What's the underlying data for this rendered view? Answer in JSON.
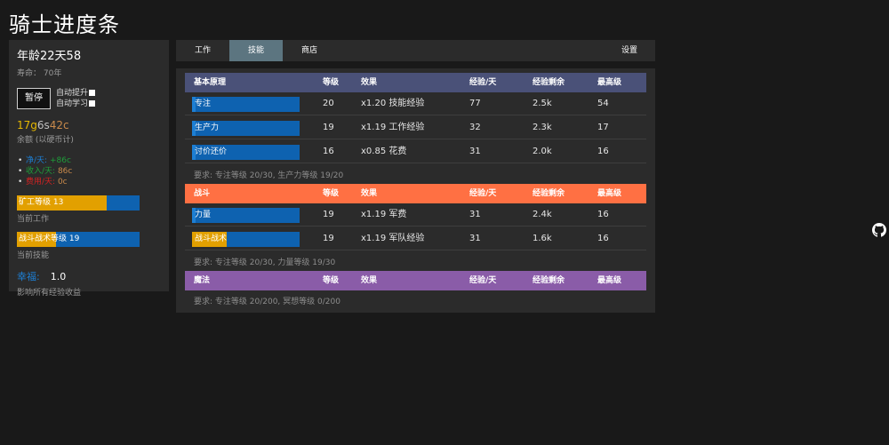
{
  "app": {
    "title": "骑士进度条"
  },
  "sidebar": {
    "age": "年龄22天58",
    "lifespan": "寿命： 70年",
    "pause_label": "暂停",
    "auto_promote_label": "自动提升",
    "auto_learn_label": "自动学习",
    "money": {
      "gold": "17g",
      "silver": "6s",
      "copper": "42c"
    },
    "balance_label": "余额 (以硬币计)",
    "stats": [
      {
        "label": "净/天:",
        "value": "+86c",
        "label_color": "#1d7fd4",
        "value_color": "#1f9e3a"
      },
      {
        "label": "收入/天:",
        "value": "86c",
        "label_color": "#1f9e3a",
        "value_color": "#c98a4b"
      },
      {
        "label": "费用/天:",
        "value": "0c",
        "label_color": "#d42222",
        "value_color": "#c98a4b"
      }
    ],
    "current_job": {
      "label": "矿工等级 13",
      "sub": "当前工作",
      "progress": 0.73
    },
    "current_skill": {
      "label": "战斗战术等级 19",
      "sub": "当前技能",
      "progress": 0.32
    },
    "happiness": {
      "label": "幸福:",
      "value": "1.0",
      "sub": "影响所有经验收益"
    }
  },
  "tabs": [
    {
      "label": "工作",
      "active": false
    },
    {
      "label": "技能",
      "active": true
    },
    {
      "label": "商店",
      "active": false
    },
    {
      "label": "设置",
      "active": false
    }
  ],
  "columns": {
    "level": "等级",
    "effect": "效果",
    "xp_day": "经验/天",
    "xp_left": "经验剩余",
    "max_level": "最高级"
  },
  "categories": [
    {
      "name": "基本原理",
      "color": "#4a5178",
      "rows": [
        {
          "name": "专注",
          "level": "20",
          "effect": "x1.20 技能经验",
          "xp_day": "77",
          "xp_left": "2.5k",
          "max": "54",
          "progress": 0.03,
          "fill": "#1d7fd4"
        },
        {
          "name": "生产力",
          "level": "19",
          "effect": "x1.19 工作经验",
          "xp_day": "32",
          "xp_left": "2.3k",
          "max": "17",
          "progress": 0.03,
          "fill": "#1d7fd4"
        },
        {
          "name": "讨价还价",
          "level": "16",
          "effect": "x0.85 花费",
          "xp_day": "31",
          "xp_left": "2.0k",
          "max": "16",
          "progress": 0.03,
          "fill": "#1d7fd4"
        }
      ],
      "requirement": "要求: 专注等级 20/30, 生产力等级 19/20"
    },
    {
      "name": "战斗",
      "color": "#ff7043",
      "rows": [
        {
          "name": "力量",
          "level": "19",
          "effect": "x1.19 军费",
          "xp_day": "31",
          "xp_left": "2.4k",
          "max": "16",
          "progress": 0.03,
          "fill": "#1d7fd4"
        },
        {
          "name": "战斗战术",
          "level": "19",
          "effect": "x1.19 军队经验",
          "xp_day": "31",
          "xp_left": "1.6k",
          "max": "16",
          "progress": 0.32,
          "fill": "#e2a000"
        }
      ],
      "requirement": "要求: 专注等级 20/30, 力量等级 19/30"
    },
    {
      "name": "魔法",
      "color": "#8a5ca8",
      "rows": [],
      "requirement": "要求: 专注等级 20/200, 冥想等级 0/200"
    }
  ]
}
